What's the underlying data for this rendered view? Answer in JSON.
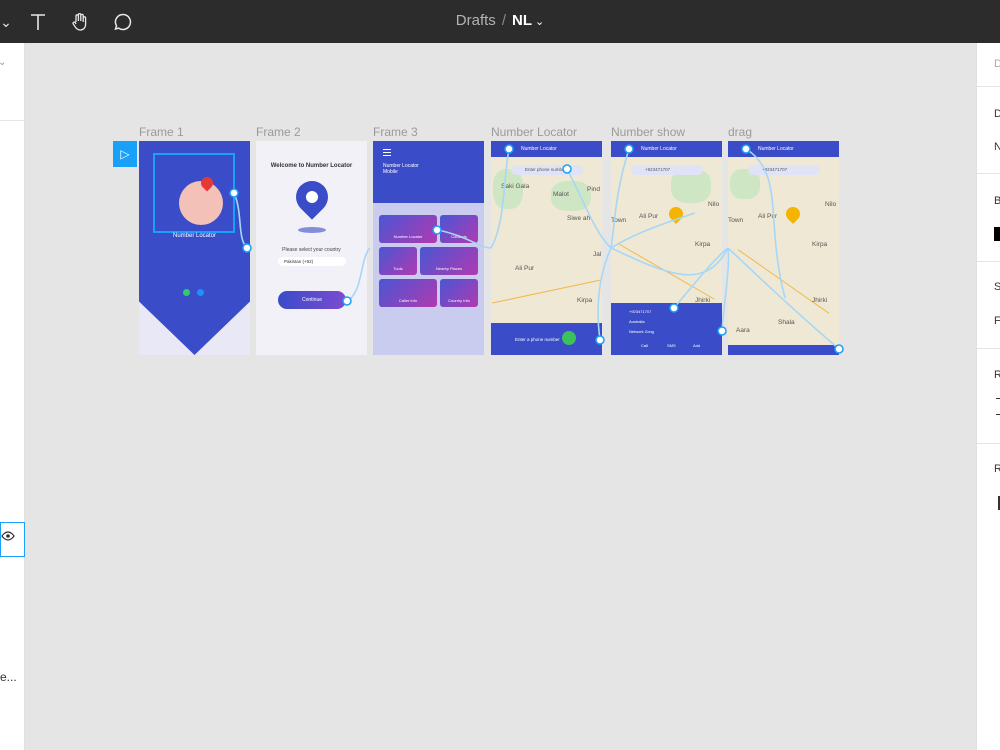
{
  "toolbar": {
    "breadcrumb_project": "Drafts",
    "separator": "/",
    "file_name": "NL",
    "file_chevron": "⌄",
    "tools": [
      "chevron-down-icon",
      "text-tool-icon",
      "hand-tool-icon",
      "comment-icon"
    ]
  },
  "left_panel": {
    "truncated_text": "e..."
  },
  "right_panel": {
    "labels": [
      "D",
      "D",
      "N",
      "B",
      "S",
      "F",
      "R",
      "R"
    ]
  },
  "canvas": {
    "start_icon": "▷",
    "frames": [
      {
        "label": "Frame 1"
      },
      {
        "label": "Frame 2"
      },
      {
        "label": "Frame 3"
      },
      {
        "label": "Number Locator"
      },
      {
        "label": "Number show"
      },
      {
        "label": "drag"
      }
    ]
  },
  "frame1": {
    "caption": "Number Locator"
  },
  "frame2": {
    "heading": "Welcome to Number Locator",
    "select_text": "Please select your country",
    "dropdown": "Pakistan (+92)",
    "button": "Continue"
  },
  "frame3": {
    "hero_title": "Number Locator Mobile",
    "tiles": [
      "Number Locator",
      "Contacts",
      "Tools",
      "Nearby Places",
      "Caller Info",
      "Country Info"
    ]
  },
  "map_locator": {
    "header": "Number Locator",
    "search_placeholder": "Enter phone number",
    "places": [
      "Saki Gala",
      "Malot",
      "Pind",
      "Siwe ah",
      "Ali Pur",
      "Kirpa",
      "Jal"
    ],
    "bottom_text": "Enter a phone number"
  },
  "map_show": {
    "header": "Number Locator",
    "search_value": "+923471707",
    "places": [
      "Ali Pur",
      "Town",
      "Nilo",
      "Kirpa",
      "Jhirki"
    ],
    "card_lines": [
      "+923471707",
      "Australia",
      "Network Zong"
    ],
    "actions": [
      "Call",
      "SMS",
      "Add"
    ]
  },
  "map_drag": {
    "header": "Number Locator",
    "search_value": "+923471707",
    "places": [
      "Ali Pur",
      "Town",
      "Nilo",
      "Kirpa",
      "Aara",
      "Shala",
      "Jhirki"
    ]
  },
  "colors": {
    "toolbar_bg": "#2c2c2c",
    "canvas_bg": "#e5e5e5",
    "selection": "#18a0fb",
    "app_blue": "#3a4cc8"
  }
}
